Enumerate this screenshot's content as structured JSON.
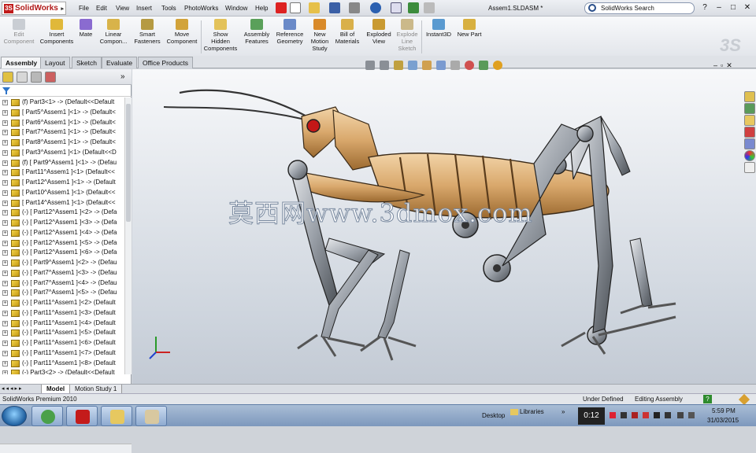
{
  "app": {
    "logo_text": "SolidWorks",
    "doc_title": "Assem1.SLDASM *"
  },
  "menu": [
    "File",
    "Edit",
    "View",
    "Insert",
    "Tools",
    "PhotoWorks",
    "Window",
    "Help"
  ],
  "search": {
    "placeholder": "SolidWorks Search"
  },
  "window_buttons": {
    "help": "?",
    "minimize": "–",
    "restore": "□",
    "close": "✕"
  },
  "commands": [
    {
      "label": "Edit\nComponent",
      "disabled": true
    },
    {
      "label": "Insert\nComponents",
      "disabled": false
    },
    {
      "label": "Mate",
      "disabled": false
    },
    {
      "label": "Linear\nCompon...",
      "disabled": false
    },
    {
      "label": "Smart\nFasteners",
      "disabled": false
    },
    {
      "label": "Move\nComponent",
      "disabled": false
    },
    {
      "label": "Show\nHidden\nComponents",
      "disabled": false
    },
    {
      "label": "Assembly\nFeatures",
      "disabled": false
    },
    {
      "label": "Reference\nGeometry",
      "disabled": false
    },
    {
      "label": "New\nMotion\nStudy",
      "disabled": false
    },
    {
      "label": "Bill of\nMaterials",
      "disabled": false
    },
    {
      "label": "Exploded\nView",
      "disabled": false
    },
    {
      "label": "Explode\nLine\nSketch",
      "disabled": true
    },
    {
      "label": "Instant3D",
      "disabled": false
    },
    {
      "label": "New Part",
      "disabled": false
    }
  ],
  "tabs": [
    "Assembly",
    "Layout",
    "Sketch",
    "Evaluate",
    "Office Products"
  ],
  "active_tab": "Assembly",
  "tree_items": [
    "(f) Part3<1> -> (Default<<Default",
    "[ Part5^Assem1 ]<1> -> (Default<",
    "[ Part6^Assem1 ]<1> -> (Default<",
    "[ Part7^Assem1 ]<1> -> (Default<",
    "[ Part8^Assem1 ]<1> -> (Default<",
    "[ Part3^Assem1 ]<1> (Default<<D",
    "(f) [ Part9^Assem1 ]<1> -> (Defau",
    "[ Part11^Assem1 ]<1> (Default<<",
    "[ Part12^Assem1 ]<1> -> (Default",
    "[ Part10^Assem1 ]<1> (Default<<",
    "[ Part14^Assem1 ]<1> (Default<<",
    "(-) [ Part12^Assem1 ]<2> -> (Defa",
    "(-) [ Part12^Assem1 ]<3> -> (Defa",
    "(-) [ Part12^Assem1 ]<4> -> (Defa",
    "(-) [ Part12^Assem1 ]<5> -> (Defa",
    "(-) [ Part12^Assem1 ]<6> -> (Defa",
    "(-) [ Part9^Assem1 ]<2> -> (Defau",
    "(-) [ Part7^Assem1 ]<3> -> (Defau",
    "(-) [ Part7^Assem1 ]<4> -> (Defau",
    "(-) [ Part7^Assem1 ]<5> -> (Defau",
    "(-) [ Part11^Assem1 ]<2> (Default",
    "(-) [ Part11^Assem1 ]<3> (Default",
    "(-) [ Part11^Assem1 ]<4> (Default",
    "(-) [ Part11^Assem1 ]<5> (Default",
    "(-) [ Part11^Assem1 ]<6> (Default",
    "(-) [ Part11^Assem1 ]<7> (Default",
    "(-) [ Part11^Assem1 ]<8> (Default",
    "(-) Part3<2> -> (Default<<Default"
  ],
  "bottom_tabs": [
    "Model",
    "Motion Study 1"
  ],
  "watermark": "莫西网www.3dmox.com",
  "status": {
    "product": "SolidWorks Premium 2010",
    "state": "Under Defined",
    "mode": "Editing Assembly",
    "help": "?"
  },
  "taskbar": {
    "desktop": "Desktop",
    "libraries": "Libraries",
    "counter": "0:12",
    "time": "5:59 PM",
    "date": "31/03/2015"
  },
  "colors": {
    "accent": "#c01b1b",
    "body_bronze": "#d9a86c",
    "leg_grey": "#8a8f96"
  }
}
